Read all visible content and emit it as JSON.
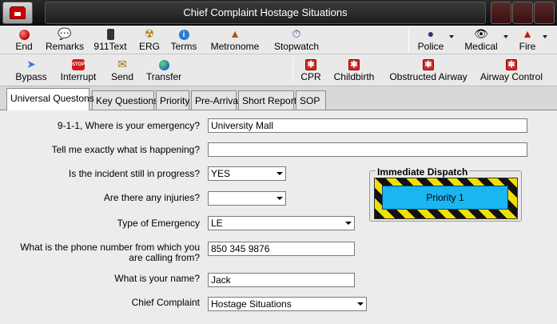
{
  "window": {
    "title": "Chief Complaint Hostage Situations"
  },
  "toolbar1": {
    "end": "End",
    "remarks": "Remarks",
    "text911": "911Text",
    "erg": "ERG",
    "terms": "Terms",
    "metronome": "Metronome",
    "stopwatch": "Stopwatch",
    "police": "Police",
    "medical": "Medical",
    "fire": "Fire"
  },
  "toolbar2": {
    "bypass": "Bypass",
    "interrupt": "Interrupt",
    "send": "Send",
    "transfer": "Transfer",
    "stop_icon_text": "STOP",
    "cpr": "CPR",
    "childbirth": "Childbirth",
    "obstructed_airway": "Obstructed Airway",
    "airway_control": "Airway Control"
  },
  "tabs": [
    "Universal Questons",
    "Key Questions",
    "Priority",
    "Pre-Arrival",
    "Short Report",
    "SOP"
  ],
  "form": {
    "q1": {
      "label": "9-1-1, Where is your emergency?",
      "value": "University Mall"
    },
    "q2": {
      "label": "Tell me exactly what is happening?",
      "value": ""
    },
    "q3": {
      "label": "Is the incident still in progress?",
      "value": "YES"
    },
    "q4": {
      "label": "Are there any injuries?",
      "value": ""
    },
    "q5": {
      "label": "Type of Emergency",
      "value": "LE"
    },
    "q6": {
      "label_line1": "What is the phone number from which you",
      "label_line2": "are calling from?",
      "value": "850 345 9876"
    },
    "q7": {
      "label": "What is your name?",
      "value": "Jack"
    },
    "q8": {
      "label": "Chief Complaint",
      "value": "Hostage Situations"
    }
  },
  "dispatch": {
    "title": "Immediate Dispatch",
    "priority": "Priority 1"
  },
  "colors": {
    "priority_bg": "#19b6f2",
    "hazard_yellow": "#f0e000",
    "cross_red": "#d42828"
  }
}
